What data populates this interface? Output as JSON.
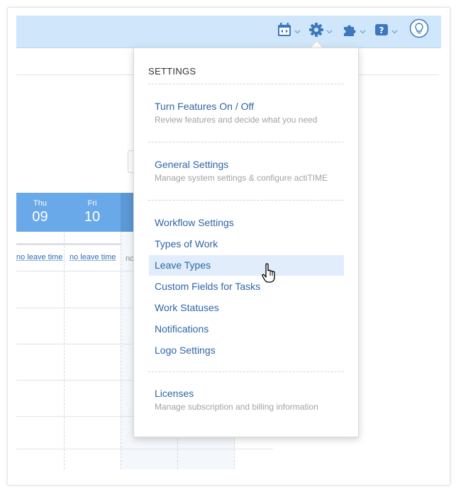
{
  "toolbar": {
    "icons": [
      "calendar-icon",
      "gear-icon",
      "puzzle-icon",
      "help-icon",
      "lightbulb-icon"
    ],
    "accent": "#3d78bf"
  },
  "calendar": {
    "days": [
      {
        "name": "Thu",
        "num": "09"
      },
      {
        "name": "Fri",
        "num": "10"
      }
    ],
    "leave_links": [
      "no leave time",
      "no leave time"
    ],
    "partial_text": "nc"
  },
  "settings_menu": {
    "title": "SETTINGS",
    "items": [
      {
        "label": "Turn Features On / Off",
        "desc": "Review features and decide what you need"
      },
      {
        "label": "General Settings",
        "desc": "Manage system settings & configure actiTIME"
      },
      {
        "label": "Workflow Settings"
      },
      {
        "label": "Types of Work"
      },
      {
        "label": "Leave Types"
      },
      {
        "label": "Custom Fields for Tasks"
      },
      {
        "label": "Work Statuses"
      },
      {
        "label": "Notifications"
      },
      {
        "label": "Logo Settings"
      },
      {
        "label": "Licenses",
        "desc": "Manage subscription and billing information"
      }
    ],
    "hovered": "Leave Types"
  }
}
